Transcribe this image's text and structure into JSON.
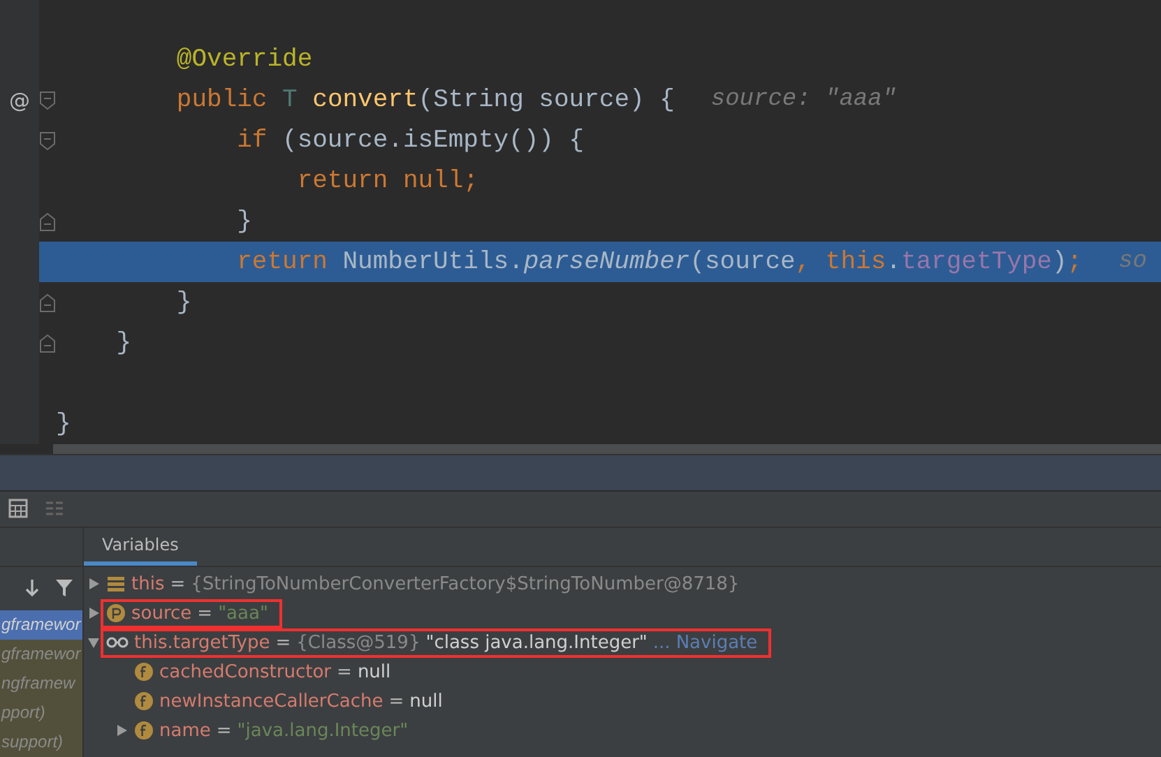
{
  "editor": {
    "lines": [
      {
        "tokens": [
          {
            "t": "        @Override",
            "kind": "annotation"
          }
        ],
        "fold_start": false,
        "fold_end": false,
        "current": false
      },
      {
        "marker": "@",
        "tokens": [
          {
            "t": "        public ",
            "kind": "keyword"
          },
          {
            "t": "T ",
            "kind": "typeparam"
          },
          {
            "t": "convert",
            "kind": "method"
          },
          {
            "t": "(String source) {",
            "kind": "plain"
          }
        ],
        "hint": "source: \"aaa\"",
        "fold_start": true,
        "fold_end": false,
        "current": false
      },
      {
        "tokens": [
          {
            "t": "            if ",
            "kind": "keyword"
          },
          {
            "t": "(source.isEmpty()) {",
            "kind": "plain"
          }
        ],
        "fold_start": true,
        "fold_end": false,
        "current": false
      },
      {
        "tokens": [
          {
            "t": "                return null;",
            "kind": "keyword"
          }
        ],
        "fold_start": false,
        "fold_end": false,
        "current": false
      },
      {
        "tokens": [
          {
            "t": "            }",
            "kind": "plain"
          }
        ],
        "fold_start": false,
        "fold_end": true,
        "current": false
      },
      {
        "tokens": [
          {
            "t": "            return ",
            "kind": "keyword"
          },
          {
            "t": "NumberUtils.",
            "kind": "plain"
          },
          {
            "t": "parseNumber",
            "kind": "static"
          },
          {
            "t": "(source",
            "kind": "plain"
          },
          {
            "t": ", ",
            "kind": "keyword"
          },
          {
            "t": "this",
            "kind": "keyword"
          },
          {
            "t": ".",
            "kind": "plain"
          },
          {
            "t": "targetType",
            "kind": "field"
          },
          {
            "t": ")",
            "kind": "plain"
          },
          {
            "t": ";",
            "kind": "keyword"
          }
        ],
        "hint": "so",
        "fold_start": false,
        "fold_end": false,
        "current": true
      },
      {
        "tokens": [
          {
            "t": "        }",
            "kind": "plain"
          }
        ],
        "fold_start": false,
        "fold_end": true,
        "current": false
      },
      {
        "tokens": [
          {
            "t": "    }",
            "kind": "plain"
          }
        ],
        "fold_start": false,
        "fold_end": true,
        "current": false
      },
      {
        "fold_start": false,
        "fold_end": false,
        "current": false
      },
      {
        "tokens": [
          {
            "t": "}",
            "kind": "plain"
          }
        ],
        "fold_start": false,
        "fold_end": false,
        "current": false
      }
    ]
  },
  "frames": {
    "items": [
      {
        "label": "gframewor",
        "selected": true
      },
      {
        "label": "gframewor",
        "selected": false
      },
      {
        "label": "ngframew",
        "selected": false
      },
      {
        "label": "pport)",
        "selected": false
      },
      {
        "label": "support)",
        "selected": false
      }
    ]
  },
  "variables": {
    "tab": {
      "label": "Variables",
      "selected": true
    },
    "rows": [
      {
        "kind": "object",
        "name": "this",
        "eq": "=",
        "values": [
          {
            "t": "{StringToNumberConverterFactory$StringToNumber@8718}",
            "kind": "ref"
          }
        ],
        "expandable": true,
        "expanded": false,
        "highlighted": false
      },
      {
        "kind": "parameter",
        "name": "source",
        "eq": "=",
        "values": [
          {
            "t": "\"aaa\"",
            "kind": "string"
          }
        ],
        "expandable": true,
        "expanded": false,
        "highlighted": true
      },
      {
        "kind": "watch",
        "name": "this.targetType",
        "eq": "=",
        "values": [
          {
            "t": "{Class@519}",
            "kind": "ref"
          },
          {
            "t": "\"class java.lang.Integer\"",
            "kind": "plain"
          },
          {
            "t": "...",
            "kind": "link"
          },
          {
            "t": "Navigate",
            "kind": "link"
          }
        ],
        "expandable": true,
        "expanded": true,
        "highlighted": true,
        "children": [
          {
            "kind": "field",
            "name": "cachedConstructor",
            "eq": "=",
            "values": [
              {
                "t": "null",
                "kind": "plain"
              }
            ],
            "expandable": false,
            "highlighted": false
          },
          {
            "kind": "field",
            "name": "newInstanceCallerCache",
            "eq": "=",
            "values": [
              {
                "t": "null",
                "kind": "plain"
              }
            ],
            "expandable": false,
            "highlighted": false
          },
          {
            "kind": "field",
            "name": "name",
            "eq": "=",
            "values": [
              {
                "t": "\"java.lang.Integer\"",
                "kind": "string"
              }
            ],
            "expandable": true,
            "expanded": false,
            "highlighted": false
          }
        ]
      }
    ]
  }
}
